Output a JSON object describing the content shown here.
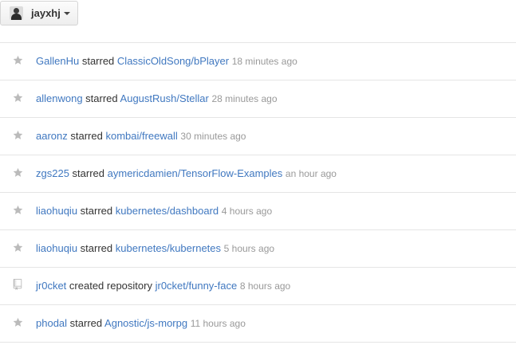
{
  "account": {
    "username": "jayxhj",
    "avatar_icon": "user-avatar",
    "caret_icon": "caret-down-icon"
  },
  "colors": {
    "link": "#4078c0",
    "text": "#333333",
    "muted": "#999999",
    "icon": "#bbbbbb",
    "divider": "#e5e5e5"
  },
  "feed": {
    "items": [
      {
        "icon": "star-icon",
        "actor": "GallenHu",
        "action": "starred",
        "target": "ClassicOldSong/bPlayer",
        "time": "18 minutes ago"
      },
      {
        "icon": "star-icon",
        "actor": "allenwong",
        "action": "starred",
        "target": "AugustRush/Stellar",
        "time": "28 minutes ago"
      },
      {
        "icon": "star-icon",
        "actor": "aaronz",
        "action": "starred",
        "target": "kombai/freewall",
        "time": "30 minutes ago"
      },
      {
        "icon": "star-icon",
        "actor": "zgs225",
        "action": "starred",
        "target": "aymericdamien/TensorFlow-Examples",
        "time": "an hour ago"
      },
      {
        "icon": "star-icon",
        "actor": "liaohuqiu",
        "action": "starred",
        "target": "kubernetes/dashboard",
        "time": "4 hours ago"
      },
      {
        "icon": "star-icon",
        "actor": "liaohuqiu",
        "action": "starred",
        "target": "kubernetes/kubernetes",
        "time": "5 hours ago"
      },
      {
        "icon": "repo-icon",
        "actor": "jr0cket",
        "action": "created repository",
        "target": "jr0cket/funny-face",
        "time": "8 hours ago"
      },
      {
        "icon": "star-icon",
        "actor": "phodal",
        "action": "starred",
        "target": "Agnostic/js-morpg",
        "time": "11 hours ago"
      }
    ]
  }
}
